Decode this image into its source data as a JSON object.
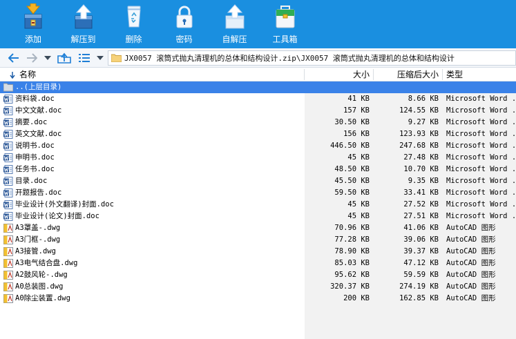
{
  "toolbar": {
    "buttons": [
      {
        "label": "添加",
        "icon": "add-archive-icon"
      },
      {
        "label": "解压到",
        "icon": "extract-to-icon"
      },
      {
        "label": "删除",
        "icon": "recycle-bin-icon"
      },
      {
        "label": "密码",
        "icon": "lock-icon"
      },
      {
        "label": "自解压",
        "icon": "self-extract-icon"
      },
      {
        "label": "工具箱",
        "icon": "toolbox-icon"
      }
    ]
  },
  "address": {
    "path": "JX0057 滚筒式抛丸清理机的总体和结构设计.zip\\JX0057 滚筒式抛丸清理机的总体和结构设计"
  },
  "columns": {
    "name": "名称",
    "size": "大小",
    "compressed": "压缩后大小",
    "type": "类型"
  },
  "parent_row": {
    "label": "..(上层目录)"
  },
  "files": [
    {
      "name": "资料袋.doc",
      "size": "41 KB",
      "compressed": "8.66 KB",
      "type": "Microsoft Word ...",
      "kind": "doc"
    },
    {
      "name": "中文文献.doc",
      "size": "157 KB",
      "compressed": "124.55 KB",
      "type": "Microsoft Word ...",
      "kind": "doc"
    },
    {
      "name": "摘要.doc",
      "size": "30.50 KB",
      "compressed": "9.27 KB",
      "type": "Microsoft Word ...",
      "kind": "doc"
    },
    {
      "name": "英文文献.doc",
      "size": "156 KB",
      "compressed": "123.93 KB",
      "type": "Microsoft Word ...",
      "kind": "doc"
    },
    {
      "name": "说明书.doc",
      "size": "446.50 KB",
      "compressed": "247.68 KB",
      "type": "Microsoft Word ...",
      "kind": "doc"
    },
    {
      "name": "申明书.doc",
      "size": "45 KB",
      "compressed": "27.48 KB",
      "type": "Microsoft Word ...",
      "kind": "doc"
    },
    {
      "name": "任务书.doc",
      "size": "48.50 KB",
      "compressed": "10.70 KB",
      "type": "Microsoft Word ...",
      "kind": "doc"
    },
    {
      "name": "目录.doc",
      "size": "45.50 KB",
      "compressed": "9.35 KB",
      "type": "Microsoft Word ...",
      "kind": "doc"
    },
    {
      "name": "开题报告.doc",
      "size": "59.50 KB",
      "compressed": "33.41 KB",
      "type": "Microsoft Word ...",
      "kind": "doc"
    },
    {
      "name": "毕业设计(外文翻译)封面.doc",
      "size": "45 KB",
      "compressed": "27.52 KB",
      "type": "Microsoft Word ...",
      "kind": "doc"
    },
    {
      "name": "毕业设计(论文)封面.doc",
      "size": "45 KB",
      "compressed": "27.51 KB",
      "type": "Microsoft Word ...",
      "kind": "doc"
    },
    {
      "name": "A3罩盖-.dwg",
      "size": "70.96 KB",
      "compressed": "41.06 KB",
      "type": "AutoCAD 图形",
      "kind": "dwg"
    },
    {
      "name": "A3门框-.dwg",
      "size": "77.28 KB",
      "compressed": "39.06 KB",
      "type": "AutoCAD 图形",
      "kind": "dwg"
    },
    {
      "name": "A3接管.dwg",
      "size": "78.90 KB",
      "compressed": "39.37 KB",
      "type": "AutoCAD 图形",
      "kind": "dwg"
    },
    {
      "name": "A3电气结合盘.dwg",
      "size": "85.03 KB",
      "compressed": "47.12 KB",
      "type": "AutoCAD 图形",
      "kind": "dwg"
    },
    {
      "name": "A2鼓风轮-.dwg",
      "size": "95.62 KB",
      "compressed": "59.59 KB",
      "type": "AutoCAD 图形",
      "kind": "dwg"
    },
    {
      "name": "A0总装图.dwg",
      "size": "320.37 KB",
      "compressed": "274.19 KB",
      "type": "AutoCAD 图形",
      "kind": "dwg"
    },
    {
      "name": "A0除尘装置.dwg",
      "size": "200 KB",
      "compressed": "162.85 KB",
      "type": "AutoCAD 图形",
      "kind": "dwg"
    }
  ],
  "colors": {
    "toolbar_bg": "#1a8fe0",
    "selection": "#3a82e8"
  }
}
